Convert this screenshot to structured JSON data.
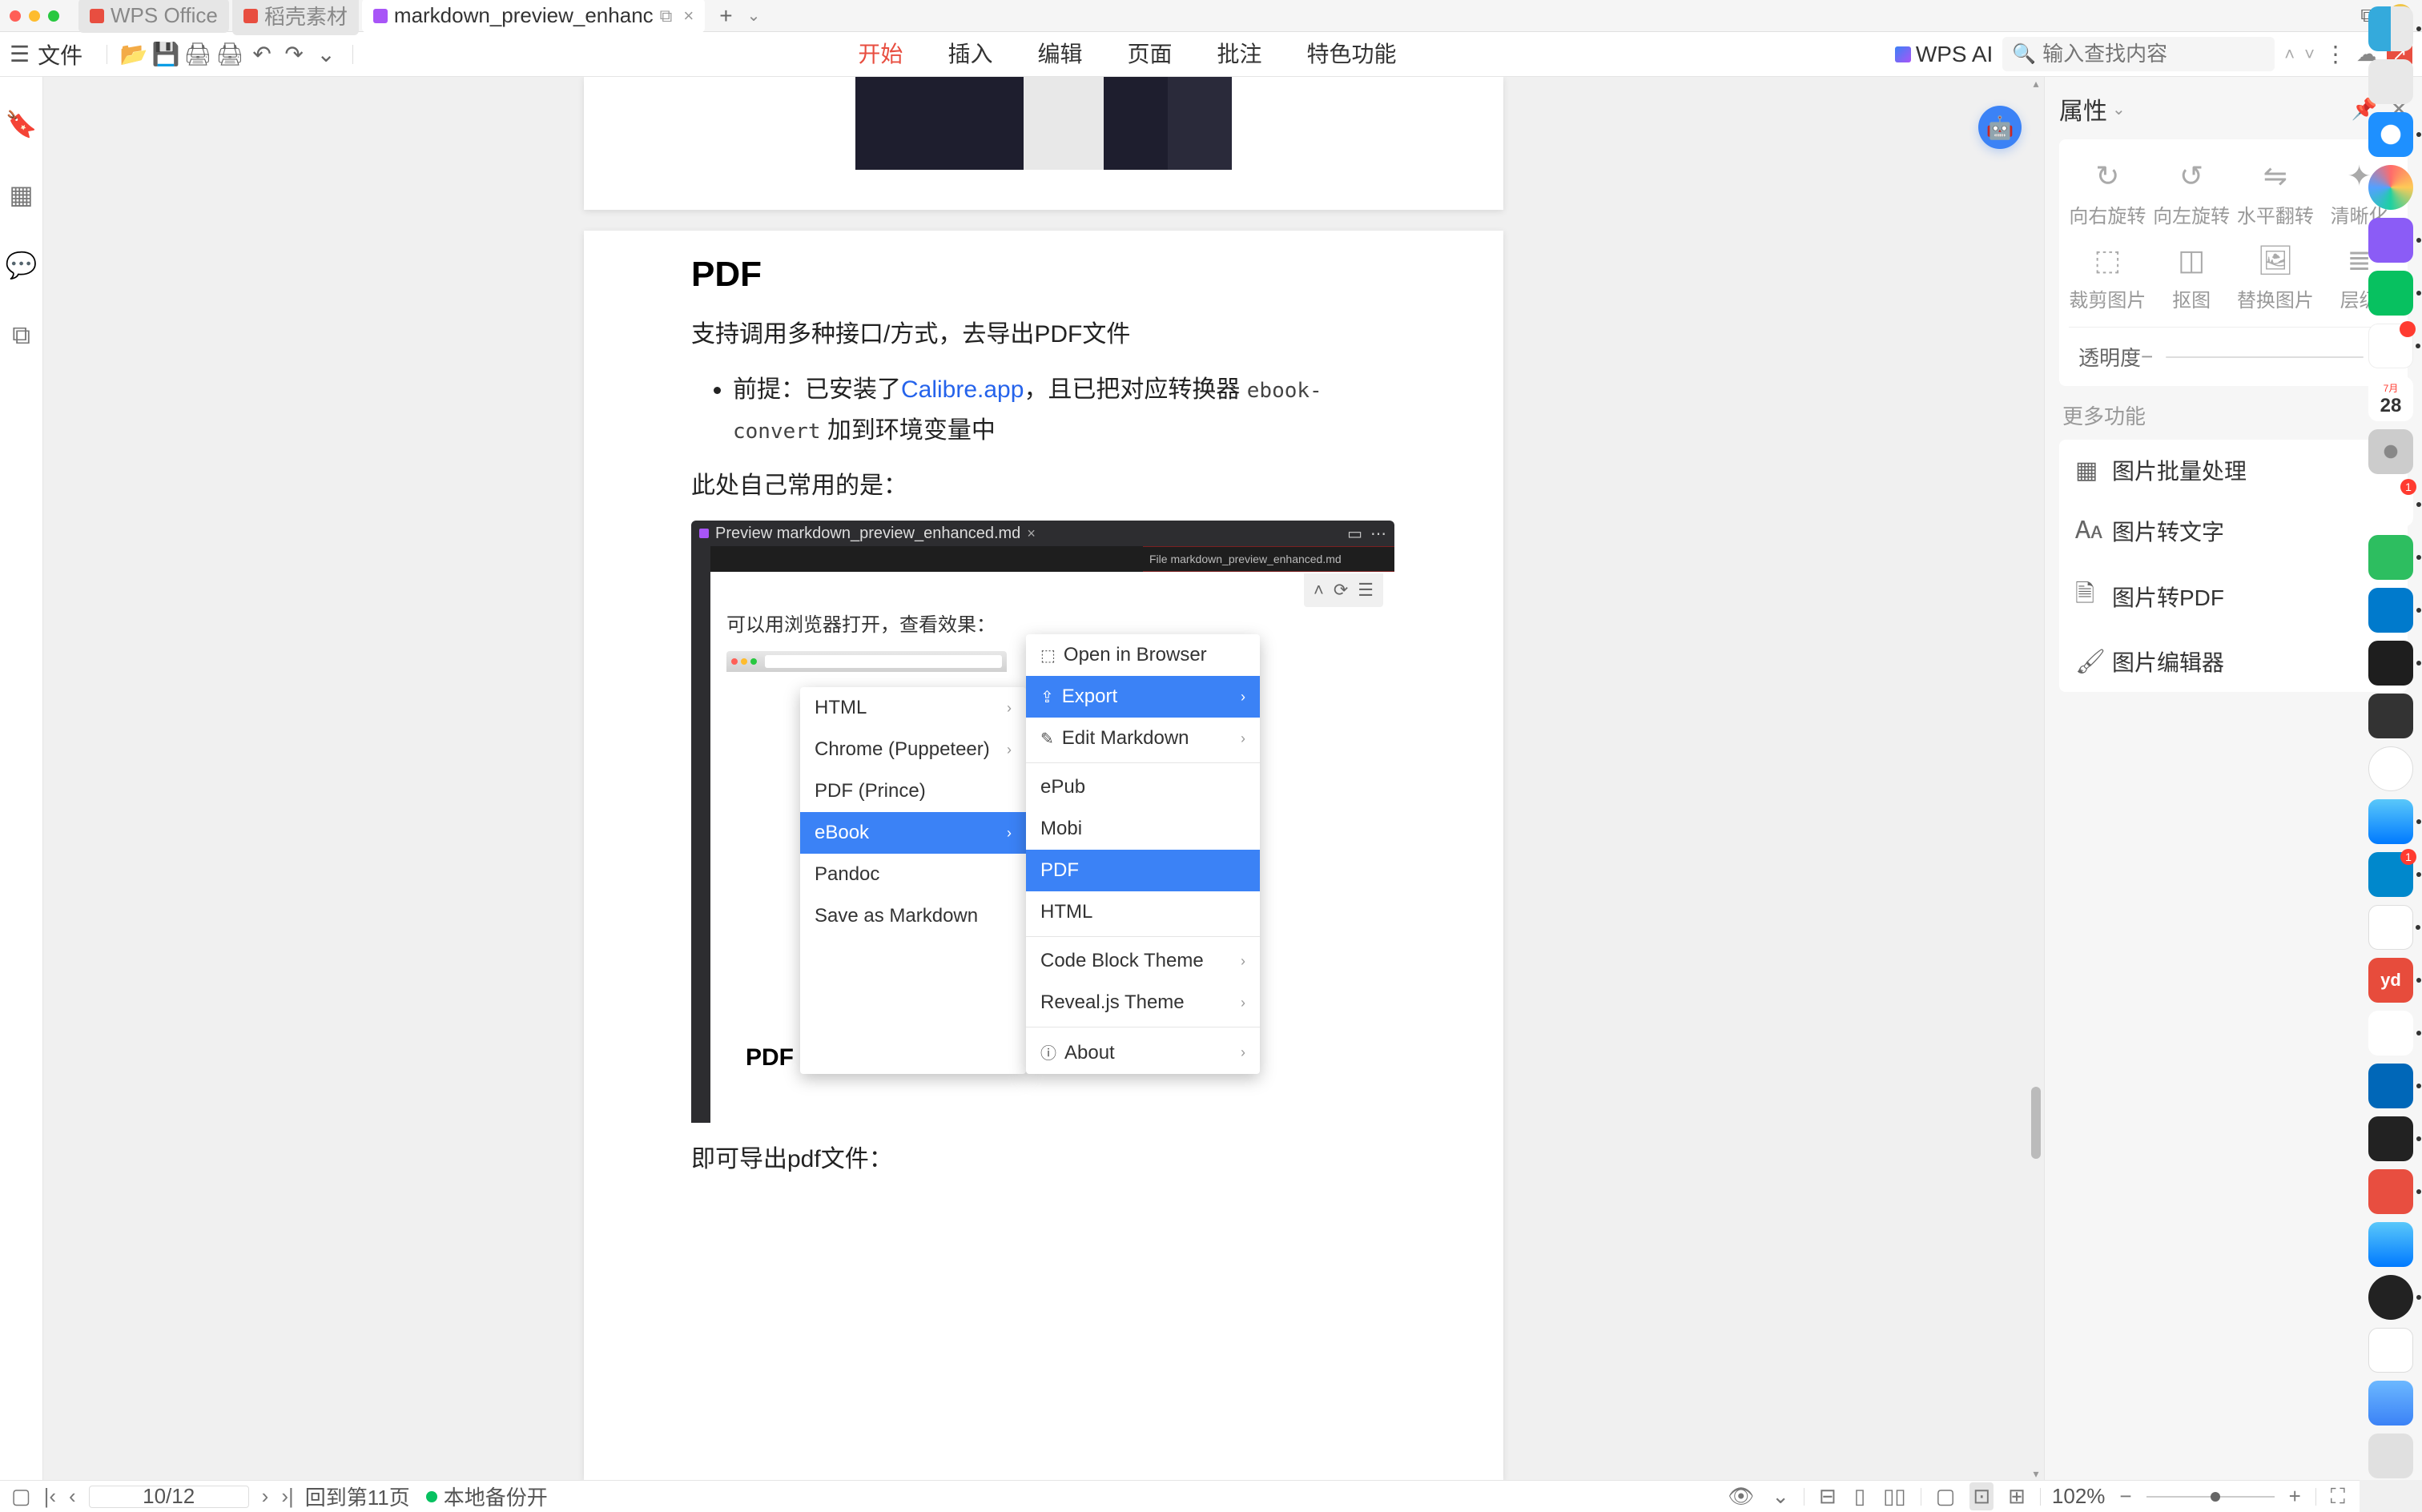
{
  "window": {
    "tabs": [
      {
        "label": "WPS Office"
      },
      {
        "label": "稻壳素材"
      },
      {
        "label": "markdown_preview_enhanc"
      }
    ],
    "new_tab_glyph": "+"
  },
  "toolbar": {
    "file_label": "文件",
    "menu": {
      "start": "开始",
      "insert": "插入",
      "edit": "编辑",
      "page": "页面",
      "annotate": "批注",
      "special": "特色功能"
    },
    "wps_ai": "WPS AI",
    "search_placeholder": "输入查找内容"
  },
  "document": {
    "page2": {
      "heading": "PDF",
      "p1": "支持调用多种接口/方式，去导出PDF文件",
      "li_pre": "前提：已安装了",
      "li_link": "Calibre.app",
      "li_post": "，且已把对应转换器 ",
      "li_code": "ebook-convert",
      "li_tail": " 加到环境变量中",
      "p2": "此处自己常用的是：",
      "shot_tab": "Preview markdown_preview_enhanced.md",
      "shot_seg2": "File markdown_preview_enhanced.md",
      "shot_browser_open": "可以用浏览器打开，查看效果：",
      "shot_h3": "PDF",
      "final_line": "即可导出pdf文件："
    },
    "menu1": {
      "html": "HTML",
      "chrome": "Chrome (Puppeteer)",
      "pdf_prince": "PDF (Prince)",
      "ebook": "eBook",
      "pandoc": "Pandoc",
      "save_md": "Save as Markdown"
    },
    "menu2": {
      "open_browser": "Open in Browser",
      "export": "Export",
      "edit_md": "Edit Markdown",
      "epub": "ePub",
      "mobi": "Mobi",
      "pdf": "PDF",
      "html": "HTML",
      "code_theme": "Code Block Theme",
      "reveal_theme": "Reveal.js Theme",
      "about": "About"
    }
  },
  "right_panel": {
    "title": "属性",
    "cells": {
      "rot_right": "向右旋转",
      "rot_left": "向左旋转",
      "flip_h": "水平翻转",
      "sharpen": "清晰化",
      "crop": "裁剪图片",
      "cutout": "抠图",
      "replace": "替换图片",
      "layer": "层级"
    },
    "opacity": "透明度",
    "more": "更多功能",
    "items": {
      "batch": "图片批量处理",
      "to_text": "图片转文字",
      "to_pdf": "图片转PDF",
      "editor": "图片编辑器"
    }
  },
  "dock": {
    "cal_mon": "7月",
    "cal_day": "28",
    "yd": "yd",
    "edge_badge": "1",
    "tg_badge": "1",
    "qq_badge": " "
  },
  "statusbar": {
    "page_input": "10/12",
    "back_to": "回到第11页",
    "backup": "本地备份开",
    "zoom": "102%"
  }
}
